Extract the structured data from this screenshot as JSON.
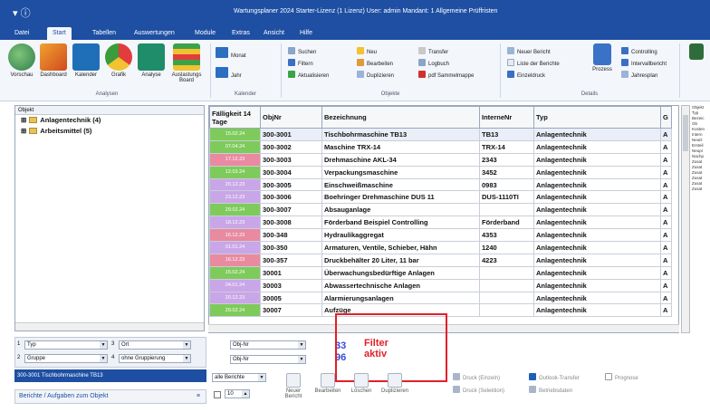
{
  "window": {
    "title": "Wartungsplaner 2024 Starter-Lizenz (1 Lizenz)   User: admin   Mandant: 1 Allgemeine Prüffristen"
  },
  "menu": [
    "Datei",
    "Start",
    "Tabellen",
    "Auswertungen",
    "Module",
    "Extras",
    "Ansicht",
    "Hilfe"
  ],
  "ribbon": {
    "analysen": {
      "label": "Analysen",
      "buttons": [
        "Vorschau",
        "Dashboard",
        "Kalender",
        "Grafik",
        "Analyse",
        "Auslastungs Board"
      ]
    },
    "kalender": {
      "label": "Kalender",
      "buttons": [
        "Monat",
        "Jahr"
      ]
    },
    "objekte": {
      "label": "Objekte",
      "buttons": [
        "Suchen",
        "Filtern",
        "Aktualisieren",
        "Neu",
        "Bearbeiten",
        "Duplizieren",
        "Transfer",
        "Logbuch",
        "pdf Sammelmappe"
      ]
    },
    "details": {
      "label": "Details",
      "buttons": [
        "Neuer Bericht",
        "Liste der Berichte",
        "Einzeldruck",
        "Prozess",
        "Controlling",
        "Intervallbericht",
        "Jahresplan"
      ]
    }
  },
  "tree": {
    "header": "Objekt",
    "nodes": [
      {
        "label": "Anlagentechnik  (4)"
      },
      {
        "label": "Arbeitsmittel  (5)"
      }
    ]
  },
  "grid": {
    "columns": [
      "Fälligkeit 14 Tage",
      "ObjNr",
      "Bezeichnung",
      "InterneNr",
      "Typ",
      "G"
    ],
    "rows": [
      {
        "date": "15.02.24",
        "color": "#7ecb5c",
        "objnr": "300-3001",
        "name": "Tischbohrmaschine TB13",
        "intern": "TB13",
        "typ": "Anlagentechnik",
        "g": "A"
      },
      {
        "date": "07.04.24",
        "color": "#7ecb5c",
        "objnr": "300-3002",
        "name": "Maschine TRX-14",
        "intern": "TRX-14",
        "typ": "Anlagentechnik",
        "g": "A"
      },
      {
        "date": "17.12.23",
        "color": "#e98aa0",
        "objnr": "300-3003",
        "name": "Drehmaschine AKL-34",
        "intern": "2343",
        "typ": "Anlagentechnik",
        "g": "A"
      },
      {
        "date": "12.03.24",
        "color": "#7ecb5c",
        "objnr": "300-3004",
        "name": "Verpackungsmaschine",
        "intern": "3452",
        "typ": "Anlagentechnik",
        "g": "A"
      },
      {
        "date": "20.12.23",
        "color": "#c9a6e8",
        "objnr": "300-3005",
        "name": "Einschweißmaschine",
        "intern": "0983",
        "typ": "Anlagentechnik",
        "g": "A"
      },
      {
        "date": "23.12.23",
        "color": "#c9a6e8",
        "objnr": "300-3006",
        "name": "Boehringer Drehmaschine DUS 11",
        "intern": "DUS-1110TI",
        "typ": "Anlagentechnik",
        "g": "A"
      },
      {
        "date": "29.02.24",
        "color": "#7ecb5c",
        "objnr": "300-3007",
        "name": "Absauganlage",
        "intern": "",
        "typ": "Anlagentechnik",
        "g": "A"
      },
      {
        "date": "18.12.23",
        "color": "#c9a6e8",
        "objnr": "300-3008",
        "name": "Förderband Beispiel Controlling",
        "intern": "Förderband",
        "typ": "Anlagentechnik",
        "g": "A"
      },
      {
        "date": "16.12.23",
        "color": "#e98aa0",
        "objnr": "300-348",
        "name": "Hydraulikaggregat",
        "intern": "4353",
        "typ": "Anlagentechnik",
        "g": "A"
      },
      {
        "date": "01.01.24",
        "color": "#c9a6e8",
        "objnr": "300-350",
        "name": "Armaturen, Ventile, Schieber, Hähn",
        "intern": "1240",
        "typ": "Anlagentechnik",
        "g": "A"
      },
      {
        "date": "16.12.23",
        "color": "#e98aa0",
        "objnr": "300-357",
        "name": "Druckbehälter 20 Liter, 11 bar",
        "intern": "4223",
        "typ": "Anlagentechnik",
        "g": "A"
      },
      {
        "date": "15.02.24",
        "color": "#7ecb5c",
        "objnr": "30001",
        "name": "Überwachungsbedürftige Anlagen",
        "intern": "",
        "typ": "Anlagentechnik",
        "g": "A"
      },
      {
        "date": "04.01.24",
        "color": "#c9a6e8",
        "objnr": "30003",
        "name": "Abwassertechnische Anlagen",
        "intern": "",
        "typ": "Anlagentechnik",
        "g": "A"
      },
      {
        "date": "20.12.23",
        "color": "#c9a6e8",
        "objnr": "30005",
        "name": "Alarmierungsanlagen",
        "intern": "",
        "typ": "Anlagentechnik",
        "g": "A"
      },
      {
        "date": "29.02.24",
        "color": "#7ecb5c",
        "objnr": "30007",
        "name": "Aufzüge",
        "intern": "",
        "typ": "Anlagentechnik",
        "g": "A"
      }
    ]
  },
  "right_strip": [
    "Objekt",
    "Typ",
    "Bezeic",
    "Ob",
    "Kosten",
    "Intern",
    "NeuD",
    "Ersteil",
    "Neupr",
    "Nachp",
    "Zusat",
    "Zusat",
    "Zusat",
    "Zusat",
    "Zusat",
    "Zusat"
  ],
  "filterbar": {
    "l1": "1",
    "v1": "Typ",
    "l2": "3",
    "v2": "Ort",
    "l3": "2",
    "v3": "Gruppe",
    "l4": "4",
    "v4": "ohne Gruppierung",
    "objnr1": "Obj-Nr",
    "objnr2": "Obj-Nr"
  },
  "counts": {
    "a": "33",
    "b": "96"
  },
  "filter_label": {
    "line1": "Filter",
    "line2": "aktiv"
  },
  "selected_object": "300-3001 Tischbohrmaschine TB13",
  "reports_panel": "Berichte / Aufgaben zum Objekt",
  "bottom": {
    "combo": "alle Berichte",
    "spinner": "10",
    "actions": [
      "Neuer Bericht",
      "Bearbeiten",
      "Löschen",
      "Duplizieren"
    ],
    "right_actions": [
      "Druck (Einzeln)",
      "Druck (Selektion)",
      "Outlook-Transfer",
      "Prognose",
      "Betriebsdaten"
    ]
  }
}
